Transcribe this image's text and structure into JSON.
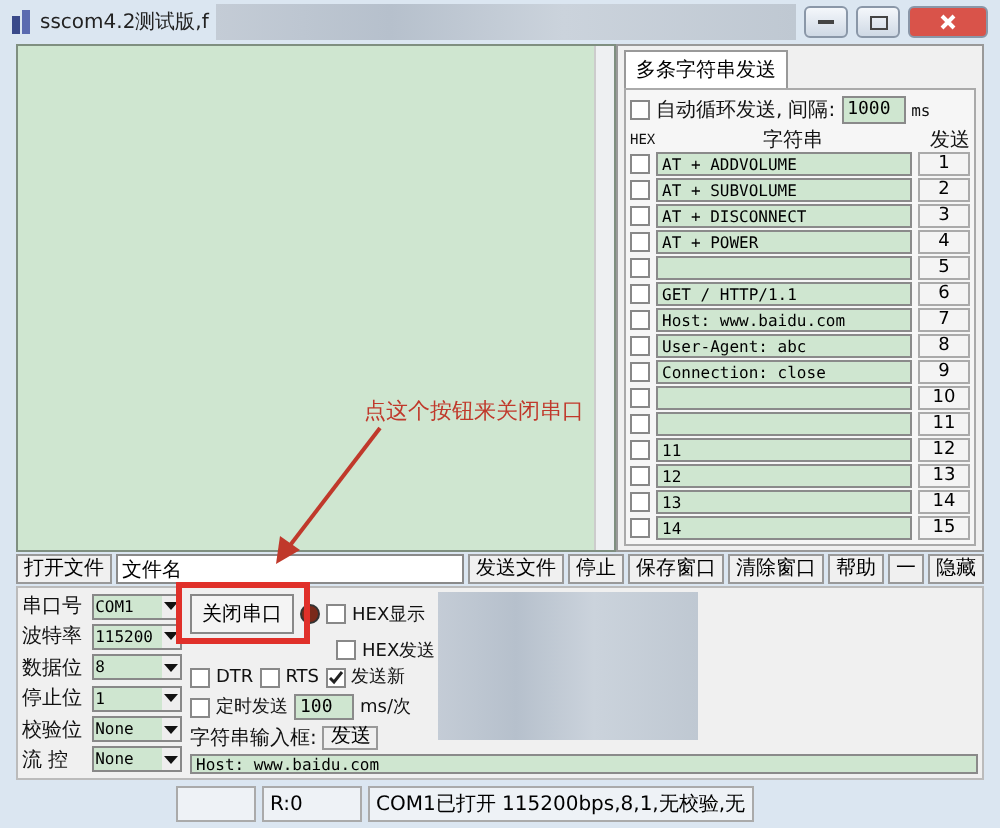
{
  "window": {
    "title": "sscom4.2测试版,f"
  },
  "multi_send": {
    "tab": "多条字符串发送",
    "auto_loop": {
      "label": "自动循环发送,",
      "checked": false
    },
    "interval_label": "间隔:",
    "interval": "1000",
    "interval_unit": "ms",
    "columns": [
      "HEX",
      "字符串",
      "发送"
    ],
    "rows": [
      {
        "hex": false,
        "text": "AT + ADDVOLUME",
        "send": "1"
      },
      {
        "hex": false,
        "text": "AT + SUBVOLUME",
        "send": "2"
      },
      {
        "hex": false,
        "text": "AT + DISCONNECT",
        "send": "3"
      },
      {
        "hex": false,
        "text": "AT + POWER",
        "send": "4"
      },
      {
        "hex": false,
        "send": "5"
      },
      {
        "hex": false,
        "text": "GET / HTTP/1.1",
        "send": "6"
      },
      {
        "hex": false,
        "text": "Host: www.baidu.com",
        "send": "7"
      },
      {
        "hex": false,
        "text": "User-Agent: abc",
        "send": "8"
      },
      {
        "hex": false,
        "text": "Connection: close",
        "send": "9"
      },
      {
        "hex": false,
        "send": "10"
      },
      {
        "hex": false,
        "send": "11"
      },
      {
        "hex": false,
        "text": "11",
        "send": "12"
      },
      {
        "hex": false,
        "text": "12",
        "send": "13"
      },
      {
        "hex": false,
        "text": "13",
        "send": "14"
      },
      {
        "hex": false,
        "text": "14",
        "send": "15"
      }
    ]
  },
  "toolbar": {
    "open_file": "打开文件",
    "filename": "文件名",
    "buttons": [
      "发送文件",
      "停止",
      "保存窗口",
      "清除窗口",
      "帮助",
      "一",
      "隐藏"
    ]
  },
  "port_settings": [
    {
      "label": "串口号",
      "value": "COM1"
    },
    {
      "label": "波特率",
      "value": "115200"
    },
    {
      "label": "数据位",
      "value": "8"
    },
    {
      "label": "停止位",
      "value": "1"
    },
    {
      "label": "校验位",
      "value": "None"
    },
    {
      "label": "流 控",
      "value": "None"
    }
  ],
  "close_port": "关闭串口",
  "options": {
    "hex_display": {
      "label": "HEX显示",
      "checked": false
    },
    "hex_send": {
      "label": "HEX发送",
      "checked": false
    },
    "dtr": {
      "label": "DTR",
      "checked": false
    },
    "rts": {
      "label": "RTS",
      "checked": false
    },
    "send_newline": {
      "label": "发送新",
      "checked": true
    },
    "timed_send": {
      "label": "定时发送",
      "checked": false
    }
  },
  "timer": {
    "value": "100",
    "unit": "ms/次"
  },
  "string_input": {
    "label": "字符串输入框:",
    "send": "发送",
    "value": "Host: www.baidu.com"
  },
  "status_bar": [
    "R:0",
    "COM1已打开  115200bps,8,1,无校验,无"
  ],
  "annotation": {
    "text": "点这个按钮来关闭串口"
  }
}
